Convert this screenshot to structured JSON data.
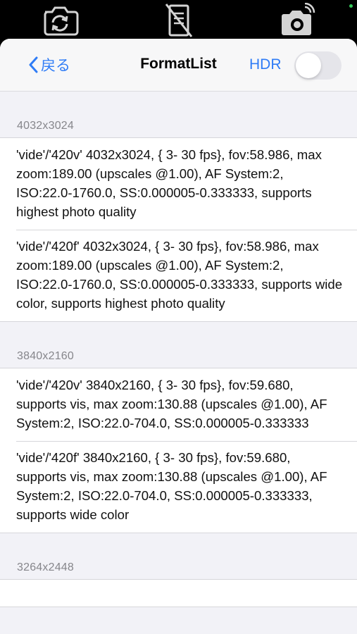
{
  "colors": {
    "accent": "#2f7cf6",
    "toggle_off": "#e5e5ea",
    "status_dot": "#34c759"
  },
  "camera_bar": {
    "icons": [
      "camera-rotate-icon",
      "no-document-icon",
      "camera-settings-icon"
    ]
  },
  "nav": {
    "back_label": "戻る",
    "title": "FormatList",
    "hdr_label": "HDR",
    "hdr_enabled": false
  },
  "sections": [
    {
      "header": "4032x3024",
      "items": [
        "'vide'/'420v' 4032x3024, { 3- 30 fps}, fov:58.986, max zoom:189.00 (upscales @1.00), AF System:2, ISO:22.0-1760.0, SS:0.000005-0.333333, supports highest photo quality",
        "'vide'/'420f' 4032x3024, { 3- 30 fps}, fov:58.986, max zoom:189.00 (upscales @1.00), AF System:2, ISO:22.0-1760.0, SS:0.000005-0.333333, supports wide color, supports highest photo quality"
      ]
    },
    {
      "header": "3840x2160",
      "items": [
        "'vide'/'420v' 3840x2160, { 3- 30 fps}, fov:59.680, supports vis, max zoom:130.88 (upscales @1.00), AF System:2, ISO:22.0-704.0, SS:0.000005-0.333333",
        "'vide'/'420f' 3840x2160, { 3- 30 fps}, fov:59.680, supports vis, max zoom:130.88 (upscales @1.00), AF System:2, ISO:22.0-704.0, SS:0.000005-0.333333, supports wide color"
      ]
    },
    {
      "header": "3264x2448",
      "items": []
    }
  ]
}
